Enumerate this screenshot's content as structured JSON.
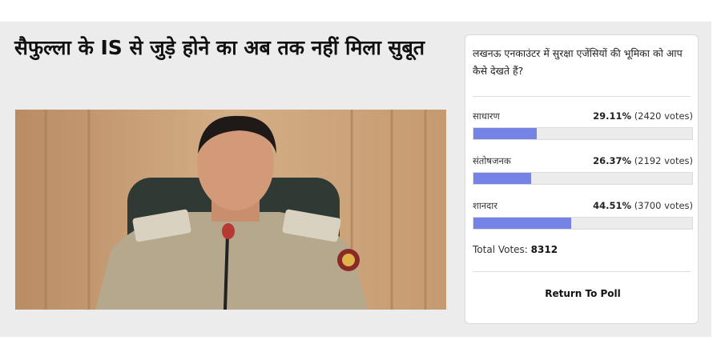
{
  "article": {
    "headline": "सैफुल्ला के IS से जुड़े होने का अब तक नहीं मिला सुबूत"
  },
  "poll": {
    "question": "लखनऊ एनकाउंटर में सुरक्षा एजेंसियों की भूमिका को आप कैसे देखते हैं?",
    "options": [
      {
        "label": "साधारण",
        "percent": "29.11%",
        "votes": "(2420 votes)",
        "fraction": 0.2911
      },
      {
        "label": "संतोषजनक",
        "percent": "26.37%",
        "votes": "(2192 votes)",
        "fraction": 0.2637
      },
      {
        "label": "शानदार",
        "percent": "44.51%",
        "votes": "(3700 votes)",
        "fraction": 0.4451
      }
    ],
    "total_label": "Total Votes:",
    "total_value": "8312",
    "return_label": "Return To Poll",
    "bar_color": "#7683e6"
  }
}
